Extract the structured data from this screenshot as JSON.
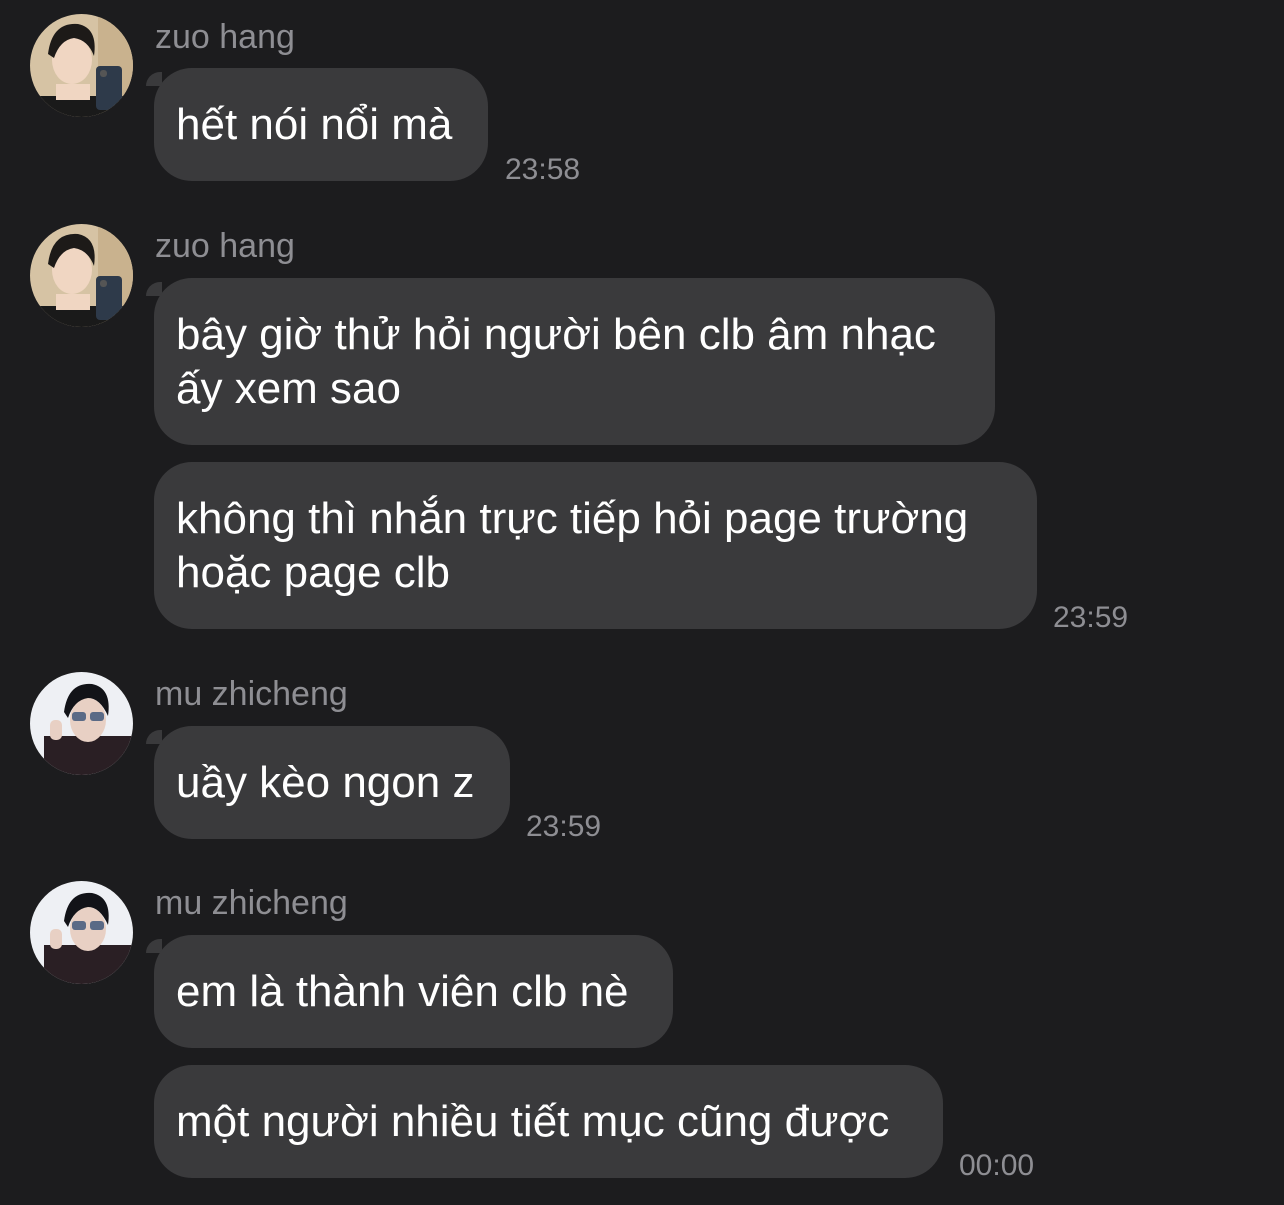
{
  "groups": [
    {
      "sender": "zuo hang",
      "avatar": "zuo-hang-avatar",
      "messages": [
        {
          "lines": [
            "hết nói nổi mà"
          ]
        }
      ],
      "time": "23:58"
    },
    {
      "sender": "zuo hang",
      "avatar": "zuo-hang-avatar",
      "messages": [
        {
          "lines": [
            "bây giờ thử hỏi người bên clb âm nhạc",
            "ấy xem sao"
          ]
        },
        {
          "lines": [
            "không thì nhắn trực tiếp hỏi page trường",
            "hoặc page clb"
          ]
        }
      ],
      "time": "23:59"
    },
    {
      "sender": "mu zhicheng",
      "avatar": "mu-zhicheng-avatar",
      "messages": [
        {
          "lines": [
            "uầy kèo ngon z"
          ]
        }
      ],
      "time": "23:59"
    },
    {
      "sender": "mu zhicheng",
      "avatar": "mu-zhicheng-avatar",
      "messages": [
        {
          "lines": [
            "em là thành viên clb nè"
          ]
        },
        {
          "lines": [
            "một người nhiều tiết mục cũng được"
          ]
        }
      ],
      "time": "00:00"
    }
  ],
  "colors": {
    "background": "#1c1c1e",
    "bubble": "#3a3a3c",
    "message_text": "#ffffff",
    "secondary_text": "#8e8e93"
  }
}
